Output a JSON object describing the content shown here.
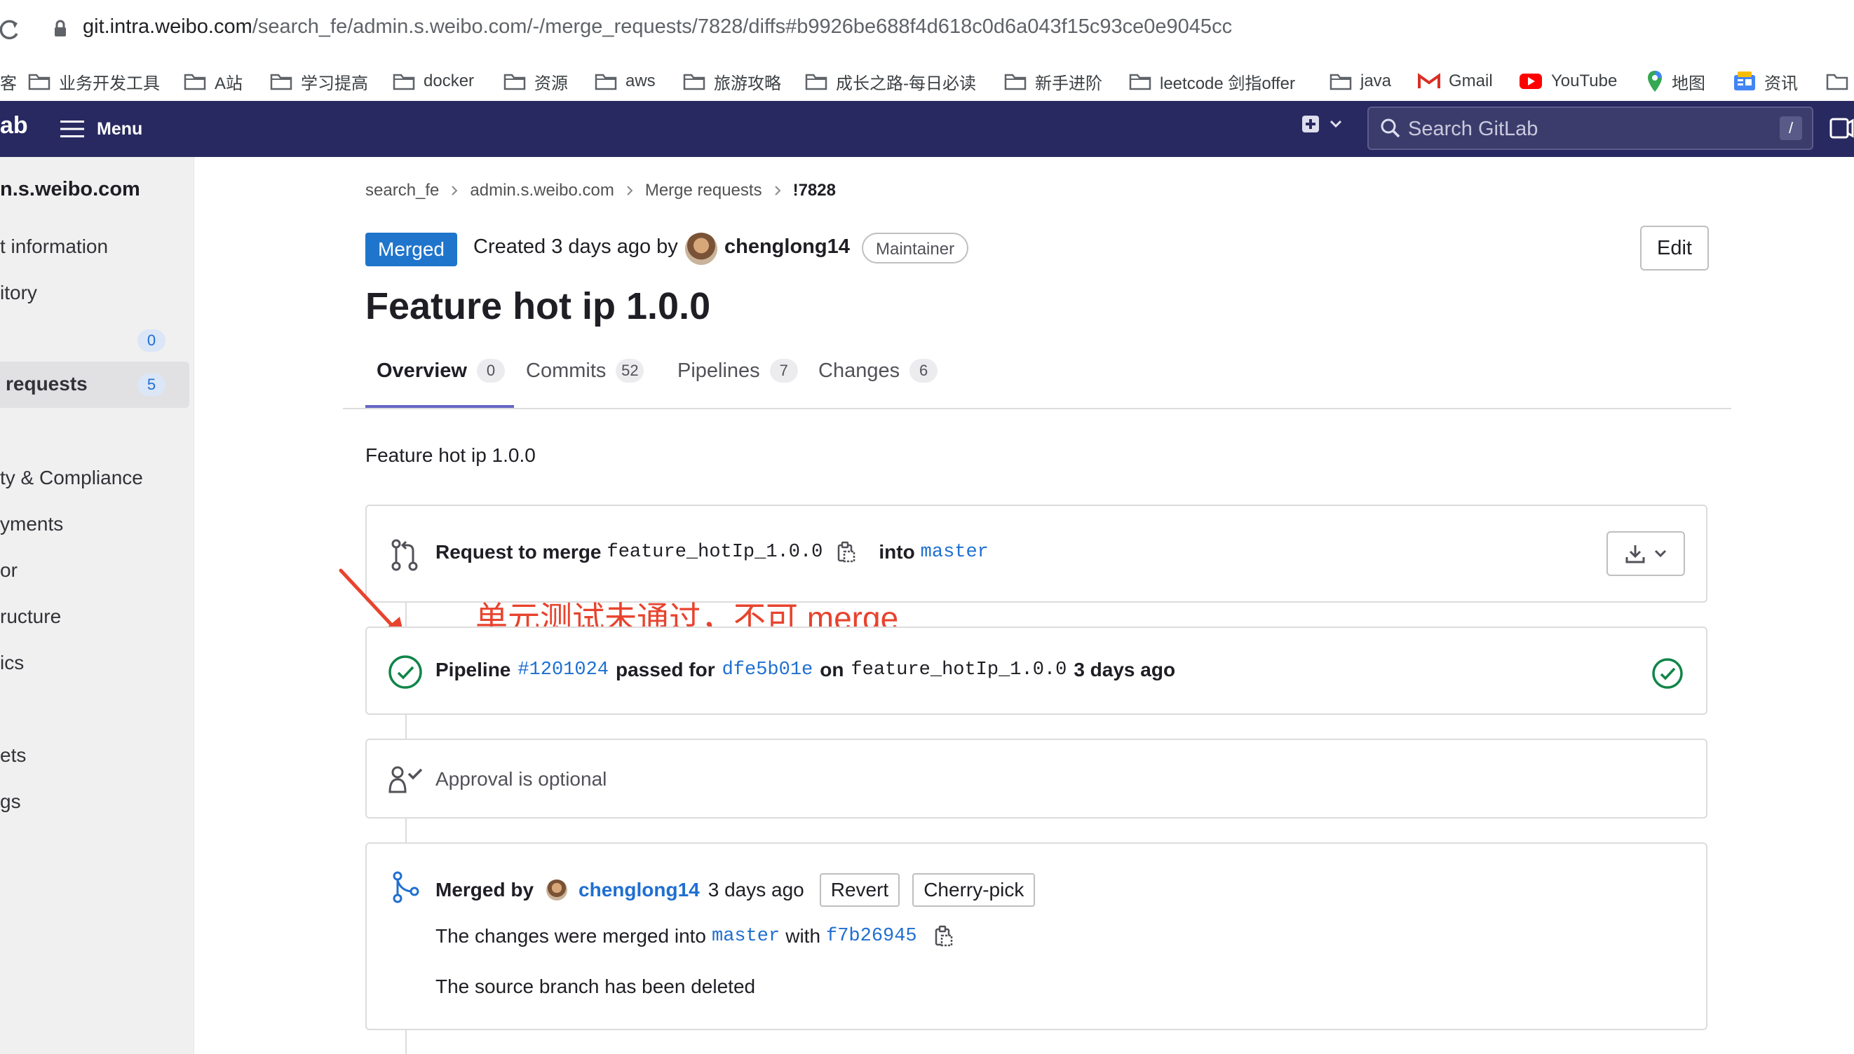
{
  "browser": {
    "url_host": "git.intra.weibo.com",
    "url_path": "/search_fe/admin.s.weibo.com/-/merge_requests/7828/diffs#b9926be688f4d618c0d6a043f15c93ce0e9045cc",
    "bookmarks": [
      "业务开发工具",
      "A站",
      "学习提高",
      "docker",
      "资源",
      "aws",
      "旅游攻略",
      "成长之路-每日必读",
      "新手进阶",
      "leetcode 剑指offer",
      "java",
      "Gmail",
      "YouTube",
      "地图",
      "资讯"
    ],
    "bookmark_partial_left": "客"
  },
  "header": {
    "logo_text": "ab",
    "menu_label": "Menu",
    "search_placeholder": "Search GitLab",
    "search_shortcut": "/"
  },
  "sidebar": {
    "project_name": "n.s.weibo.com",
    "items": [
      {
        "label": "t information"
      },
      {
        "label": "itory"
      },
      {
        "label": "",
        "count": "0"
      },
      {
        "label": "requests",
        "count": "5"
      },
      {
        "label": "ty & Compliance"
      },
      {
        "label": "yments"
      },
      {
        "label": "or"
      },
      {
        "label": "ructure"
      },
      {
        "label": "ics"
      },
      {
        "label": "ets"
      },
      {
        "label": "gs"
      }
    ]
  },
  "breadcrumb": [
    "search_fe",
    "admin.s.weibo.com",
    "Merge requests",
    "!7828"
  ],
  "mr": {
    "status": "Merged",
    "created_text": "Created 3 days ago by",
    "author": "chenglong14",
    "role": "Maintainer",
    "edit_label": "Edit",
    "title": "Feature hot ip 1.0.0",
    "description": "Feature hot ip 1.0.0"
  },
  "tabs": [
    {
      "label": "Overview",
      "count": "0"
    },
    {
      "label": "Commits",
      "count": "52"
    },
    {
      "label": "Pipelines",
      "count": "7"
    },
    {
      "label": "Changes",
      "count": "6"
    }
  ],
  "merge_request_card": {
    "prefix": "Request to merge",
    "source_branch": "feature_hotIp_1.0.0",
    "into": "into",
    "target_branch": "master"
  },
  "annotation": {
    "text": "单元测试未通过，不可 merge",
    "color": "#e8432e"
  },
  "pipeline": {
    "label": "Pipeline",
    "id": "#1201024",
    "passed_for": "passed for",
    "commit": "dfe5b01e",
    "on": "on",
    "branch": "feature_hotIp_1.0.0",
    "time": "3 days ago"
  },
  "approval": {
    "text": "Approval is optional"
  },
  "merged": {
    "prefix": "Merged by",
    "user": "chenglong14",
    "time": "3 days ago",
    "revert_label": "Revert",
    "cherry_pick_label": "Cherry-pick",
    "changes_prefix": "The changes were merged into",
    "target_branch": "master",
    "with": "with",
    "commit": "f7b26945",
    "source_deleted": "The source branch has been deleted"
  },
  "colors": {
    "header_bg": "#292961",
    "accent": "#1f75cb",
    "success": "#108548",
    "link": "#1f6fd0",
    "tab_underline": "#6666c4"
  }
}
